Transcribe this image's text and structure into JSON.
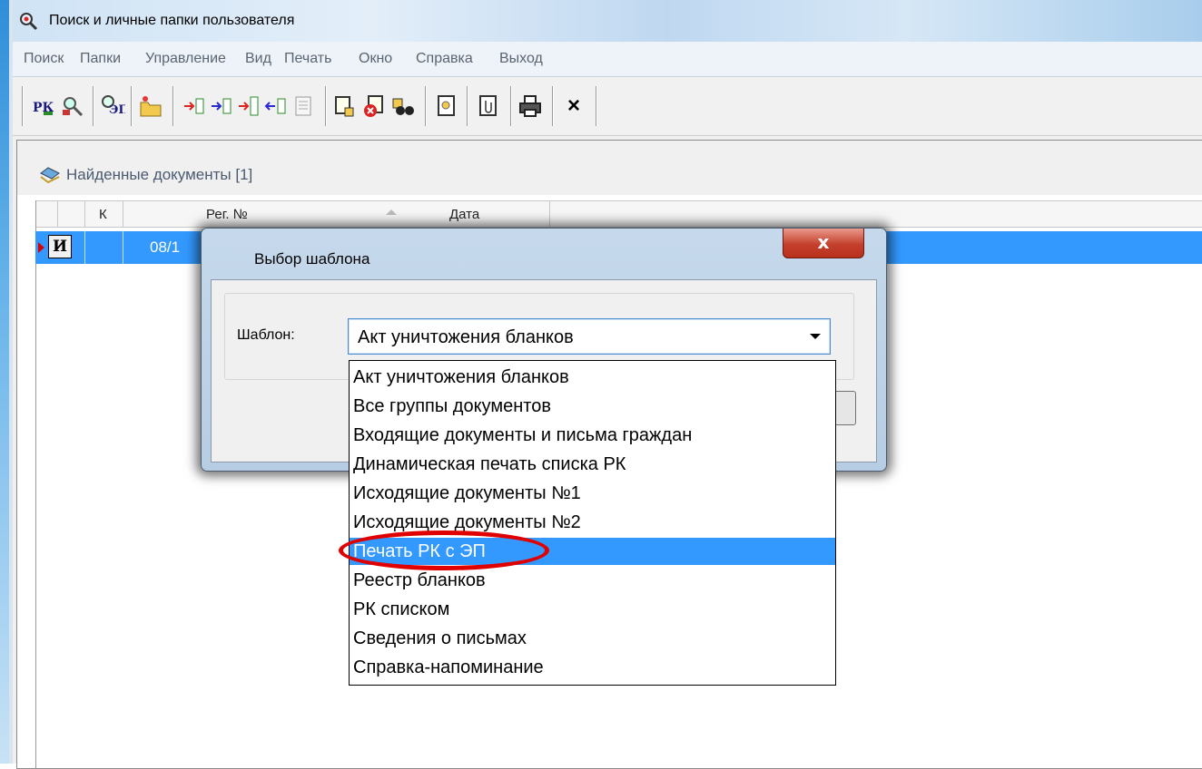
{
  "window": {
    "title": "Поиск и личные папки пользователя"
  },
  "menu": {
    "items": [
      "Поиск",
      "Папки",
      "Управление",
      "Вид",
      "Печать",
      "Окно",
      "Справка",
      "Выход"
    ]
  },
  "toolbar": {
    "buttons": [
      {
        "icon": "rk-icon",
        "text": "РК"
      },
      {
        "icon": "search-user-icon",
        "text": ""
      },
      {
        "icon": "ep-icon",
        "text": "ЭП"
      },
      {
        "icon": "new-folder-icon",
        "text": ""
      },
      {
        "icon": "add-to-folder-icon",
        "text": ""
      },
      {
        "icon": "add-all-icon",
        "text": ""
      },
      {
        "icon": "move-icon",
        "text": ""
      },
      {
        "icon": "remove-from-folder-icon",
        "text": ""
      },
      {
        "icon": "list-icon",
        "text": ""
      },
      {
        "icon": "select-doc-icon",
        "text": ""
      },
      {
        "icon": "delete-doc-icon",
        "text": ""
      },
      {
        "icon": "binoculars-icon",
        "text": ""
      },
      {
        "icon": "view-doc-icon",
        "text": ""
      },
      {
        "icon": "attachment-icon",
        "text": ""
      },
      {
        "icon": "printer-icon",
        "text": ""
      },
      {
        "icon": "close-icon",
        "text": "×"
      }
    ]
  },
  "panel": {
    "title": "Найденные документы  [1]",
    "columns": [
      "К",
      "Рег. №",
      "Дата"
    ],
    "rows": [
      {
        "type_glyph": "И",
        "reg": "08/1"
      }
    ]
  },
  "dialog": {
    "title": "Выбор шаблона",
    "close_label": "x",
    "template_label": "Шаблон:",
    "selected_value": "Акт уничтожения бланков",
    "options": [
      "Акт уничтожения бланков",
      "Все группы документов",
      "Входящие документы и письма граждан",
      "Динамическая печать списка РК",
      "Исходящие документы №1",
      "Исходящие документы №2",
      "Печать РК с ЭП",
      "Реестр бланков",
      "РК списком",
      "Сведения о письмах",
      "Справка-напоминание"
    ],
    "highlighted_option": "Печать РК с ЭП"
  },
  "colors": {
    "selection": "#3399ff",
    "highlight_ring": "#e00000",
    "close_button": "#c4402d"
  }
}
